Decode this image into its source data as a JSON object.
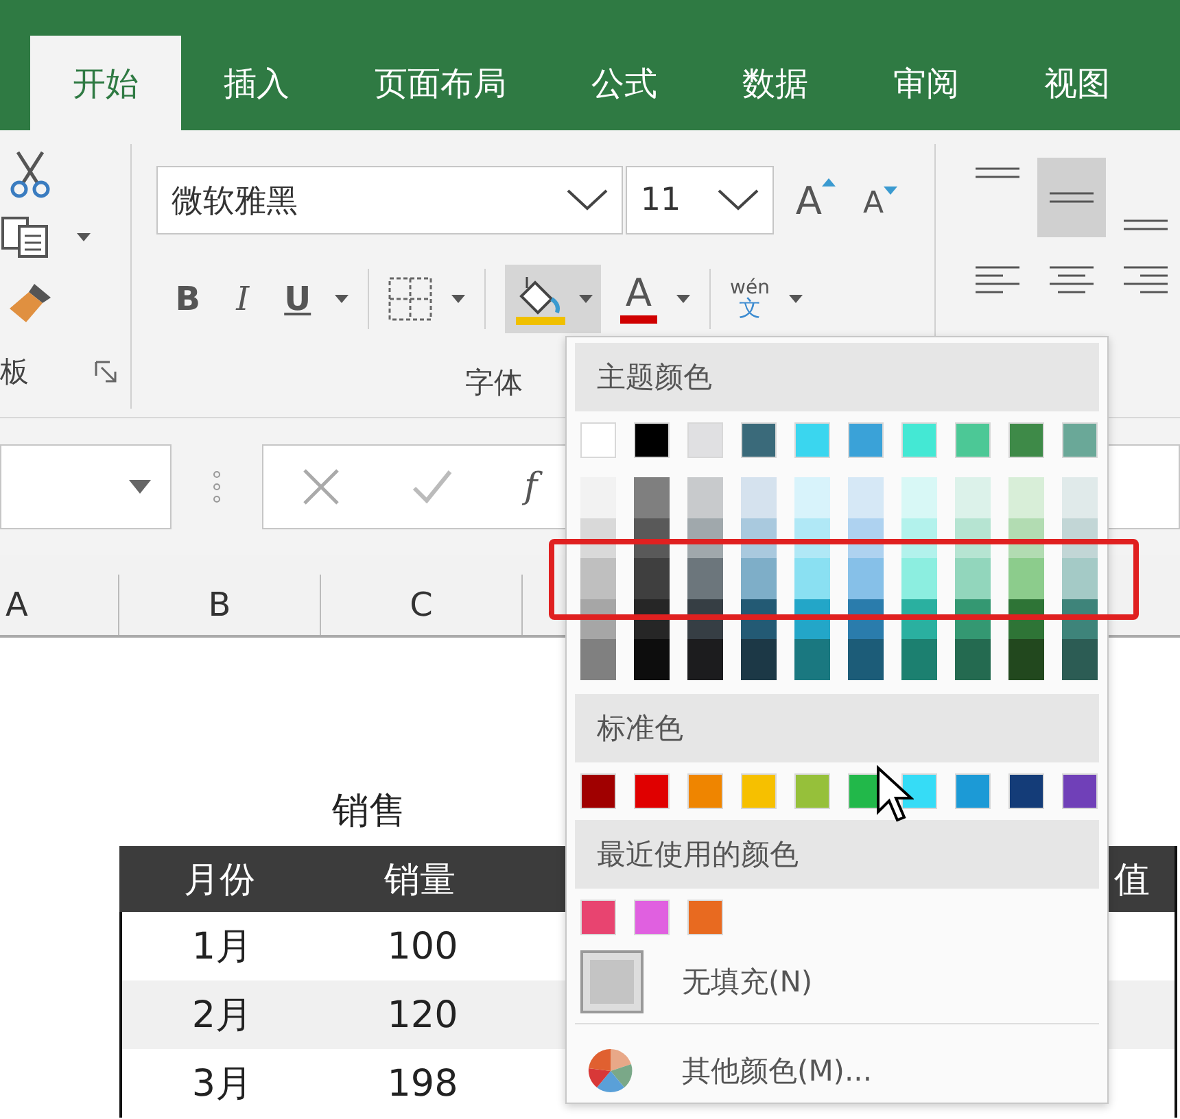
{
  "tabs": [
    {
      "label": "开始",
      "selected": true
    },
    {
      "label": "插入",
      "selected": false
    },
    {
      "label": "页面布局",
      "selected": false
    },
    {
      "label": "公式",
      "selected": false
    },
    {
      "label": "数据",
      "selected": false
    },
    {
      "label": "审阅",
      "selected": false
    },
    {
      "label": "视图",
      "selected": false
    }
  ],
  "clipboard": {
    "group_label": "板"
  },
  "font": {
    "name": "微软雅黑",
    "size": "11",
    "grow_label": "A",
    "shrink_label": "A",
    "bold_label": "B",
    "italic_label": "I",
    "underline_label": "U",
    "fill_pressed": true,
    "font_color_label": "A",
    "phonetic_top": "wén",
    "phonetic_bottom": "文",
    "group_label": "字体"
  },
  "alignment": [
    {
      "kind": "top",
      "selected": false
    },
    {
      "kind": "middle",
      "selected": true
    },
    {
      "kind": "bottom",
      "selected": false
    },
    {
      "kind": "left",
      "selected": false
    },
    {
      "kind": "center",
      "selected": false
    },
    {
      "kind": "right",
      "selected": false
    }
  ],
  "formula_bar": {
    "function_label": "f"
  },
  "column_headers": [
    "A",
    "B",
    "C"
  ],
  "sheet": {
    "title": "销售",
    "columns": [
      "月份",
      "销量",
      "值"
    ],
    "rows": [
      {
        "cells": [
          "1月",
          "100"
        ],
        "shaded": false
      },
      {
        "cells": [
          "2月",
          "120"
        ],
        "shaded": true
      },
      {
        "cells": [
          "3月",
          "198"
        ],
        "shaded": false
      }
    ]
  },
  "fill_menu": {
    "theme_heading": "主题颜色",
    "theme_colors": [
      {
        "color": "#ffffff",
        "shades": [
          {
            "color": "#f2f2f2"
          },
          {
            "color": "#d9d9d9"
          },
          {
            "color": "#bfbfbf"
          },
          {
            "color": "#a6a6a6"
          },
          {
            "color": "#808080"
          }
        ]
      },
      {
        "color": "#000000",
        "shades": [
          {
            "color": "#7f7f7f"
          },
          {
            "color": "#595959"
          },
          {
            "color": "#3f3f3f"
          },
          {
            "color": "#262626"
          },
          {
            "color": "#0d0d0d"
          }
        ]
      },
      {
        "color": "#e0e0e2",
        "shades": [
          {
            "color": "#c8cacc"
          },
          {
            "color": "#a0a8ac"
          },
          {
            "color": "#6c767c"
          },
          {
            "color": "#363e44"
          },
          {
            "color": "#1c1c1e"
          }
        ]
      },
      {
        "color": "#3a6a7a",
        "shades": [
          {
            "color": "#d5e2ee"
          },
          {
            "color": "#a9c9de"
          },
          {
            "color": "#7eaec8"
          },
          {
            "color": "#235a74"
          },
          {
            "color": "#1c3846"
          }
        ]
      },
      {
        "color": "#3ad6ef",
        "shades": [
          {
            "color": "#d8f3fb"
          },
          {
            "color": "#b0e8f6"
          },
          {
            "color": "#8ae0f2"
          },
          {
            "color": "#23a6c8"
          },
          {
            "color": "#1a7880"
          }
        ]
      },
      {
        "color": "#3aa2d8",
        "shades": [
          {
            "color": "#d6e8f6"
          },
          {
            "color": "#aed2f0"
          },
          {
            "color": "#86c0e8"
          },
          {
            "color": "#2a7cac"
          },
          {
            "color": "#1c5c78"
          }
        ]
      },
      {
        "color": "#44e8d4",
        "shades": [
          {
            "color": "#d8f8f6"
          },
          {
            "color": "#b2f2ec"
          },
          {
            "color": "#8ceee0"
          },
          {
            "color": "#2ab0a0"
          },
          {
            "color": "#1c8070"
          }
        ]
      },
      {
        "color": "#4cc896",
        "shades": [
          {
            "color": "#dcf2ea"
          },
          {
            "color": "#b6e4d2"
          },
          {
            "color": "#92d6bc"
          },
          {
            "color": "#349872"
          },
          {
            "color": "#246a50"
          }
        ]
      },
      {
        "color": "#3e8a48",
        "shades": [
          {
            "color": "#d8eed8"
          },
          {
            "color": "#b2dcb2"
          },
          {
            "color": "#8ccc8c"
          },
          {
            "color": "#2e7436"
          },
          {
            "color": "#22481e"
          }
        ]
      },
      {
        "color": "#6aa898",
        "shades": [
          {
            "color": "#e0eaea"
          },
          {
            "color": "#c2d6d6"
          },
          {
            "color": "#a4cac6"
          },
          {
            "color": "#3e847a"
          },
          {
            "color": "#2c5c54"
          }
        ]
      }
    ],
    "standard_heading": "标准色",
    "standard_colors": [
      {
        "color": "#a00000"
      },
      {
        "color": "#e00000"
      },
      {
        "color": "#ef8500"
      },
      {
        "color": "#f6c000"
      },
      {
        "color": "#96c03a"
      },
      {
        "color": "#22b84a"
      },
      {
        "color": "#36dcf6"
      },
      {
        "color": "#1c9ad6"
      },
      {
        "color": "#143c78"
      },
      {
        "color": "#7040b8"
      }
    ],
    "recent_heading": "最近使用的颜色",
    "recent_colors": [
      {
        "color": "#e84470"
      },
      {
        "color": "#e060e0"
      },
      {
        "color": "#e86a20"
      }
    ],
    "no_fill": "无填充(N)",
    "more_colors": "其他颜色(M)..."
  }
}
